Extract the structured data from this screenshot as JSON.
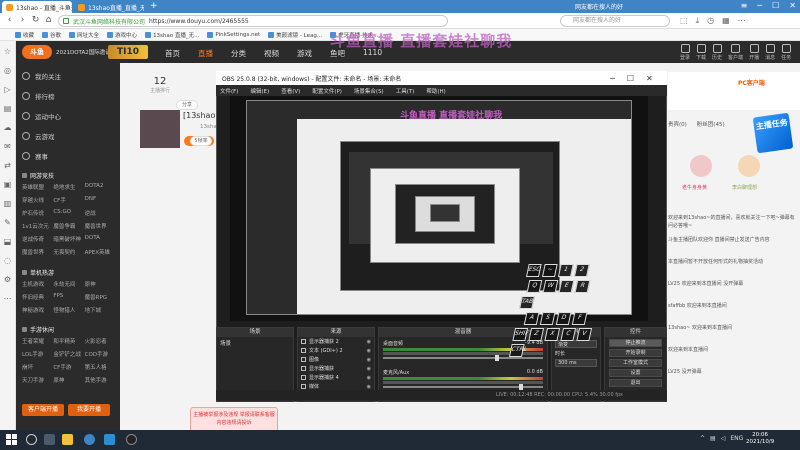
{
  "browser": {
    "tabs": [
      {
        "label": "13shao - 直播_斗鱼无限画质_无弹幕"
      },
      {
        "label": "13shao直播_直播_无弹幕"
      }
    ],
    "url": "https://www.douyu.com/2465555",
    "cert_owner": "武汉斗鱼网络科技有限公司",
    "search_placeholder": "网友都在搜人的好",
    "promo": "网友都在搜人的好",
    "bookmarks": [
      "收藏",
      "谷歌",
      "网址大全",
      "游戏中心",
      "13shao 直播_无...",
      "PinkSettings.net",
      "美颜滤镜 - Leag...",
      "虎牙直播-技术..."
    ]
  },
  "douyu": {
    "event_text": "2021DOTA2国际邀请赛",
    "logo_text": "斗鱼",
    "event_logo": "TI10",
    "nav": [
      "首页",
      "直播",
      "分类",
      "视频",
      "游戏",
      "鱼吧",
      "1110"
    ],
    "header_right": [
      "登录",
      "下载",
      "历史",
      "客户端",
      "开播",
      "消息",
      "任务"
    ],
    "overlay_title": "斗鱼直播 直播套娃社聊我",
    "sidebar_top": [
      "我的关注",
      "排行榜",
      "运动中心",
      "云游戏",
      "赛事"
    ],
    "sections": [
      {
        "title": "网游竞技",
        "items": [
          "英雄联盟",
          "绝地求生",
          "DOTA2",
          "穿越火线",
          "CF手",
          "DNF",
          "炉石传说",
          "CS:GO",
          "逆战",
          "1v1云次元",
          "魔兽争霸",
          "魔兽世界",
          "逆战传奇",
          "暗黑破坏神",
          "DOTA",
          "魔兽世界",
          "无畏契约",
          "APEX英雄"
        ]
      },
      {
        "title": "单机热游",
        "items": [
          "主机游戏",
          "永劫无间",
          "原神",
          "怀旧经典",
          "FPS",
          "魔兽RPG",
          "神秘游戏",
          "怪物猎人",
          "地下城"
        ]
      },
      {
        "title": "手游休闲",
        "items": [
          "王者荣耀",
          "和平精英",
          "火影忍者",
          "LOL手游",
          "金铲铲之战",
          "COD手游",
          "崩坏",
          "CF手游",
          "第五人格",
          "天刀手游",
          "原神",
          "其他手游"
        ]
      }
    ],
    "sidebar_buttons": [
      "客户端开播",
      "我要开播"
    ],
    "rank_count": "12",
    "rank_label": "主播排行",
    "subscribe": "+ 关注",
    "anchor_name": "[13shao]",
    "anchor_id": "13shao",
    "report": "举报",
    "bullet_buttons": [
      "分享",
      "5帧率"
    ],
    "pc_client": "PC客户端",
    "right_tabs": [
      "贵宾(0)",
      "粉丝团(45)"
    ],
    "guard_label": "主播任务",
    "avatars": [
      {
        "name": "老牛身身黄"
      },
      {
        "name": "李白聊理想"
      }
    ],
    "chat": [
      "欢迎来到13shao~的直播间，喜欢就关注一下吧~弹幕有问必答哦~",
      "斗鱼主播团队欢迎你 直播间禁止发送广告内容",
      "本直播间暂不开放任何形式的礼物抽奖活动",
      "LV25 欢迎来到本直播间 没开弹幕",
      "sfaffbb 欢迎来到本直播间",
      "13shao~ 欢迎来到本直播间",
      "欢迎来到本直播间",
      "LV25 没开弹幕"
    ],
    "bottom_note": "主播被举报涉及违规 举报请联系客服 内容违规请投诉"
  },
  "obs": {
    "title": "OBS 25.0.8 (32-bit, windows) - 配置文件: 未命名 - 场景: 未命名",
    "menu": [
      "文件(F)",
      "编辑(E)",
      "查看(V)",
      "配置文件(P)",
      "场景集合(S)",
      "工具(T)",
      "帮助(H)"
    ],
    "preview_title": "斗鱼直播 直播套娃社聊我",
    "docks": {
      "scenes": {
        "title": "场景",
        "items": [
          "场景"
        ]
      },
      "sources": {
        "title": "来源",
        "items": [
          "显示器捕获 2",
          "文本 (GDI+) 2",
          "图像",
          "显示器捕获",
          "显示器捕获 4",
          "媒体"
        ]
      },
      "mixer": {
        "title": "混音器",
        "tracks": [
          {
            "name": "桌面音频",
            "db": "-9.4 dB"
          },
          {
            "name": "麦克风/Aux",
            "db": "0.0 dB"
          }
        ]
      },
      "transitions": {
        "title": "转场特效",
        "label": "渐变",
        "duration_label": "时长",
        "duration": "300 ms"
      },
      "controls": {
        "title": "控件",
        "buttons": [
          "停止推流",
          "开始录制",
          "工作室模式",
          "设置",
          "退出"
        ]
      }
    },
    "status": "LIVE: 00:12:48  REC: 00:00:00  CPU: 5.4%  30.00 fps"
  },
  "keyboard": {
    "keys": [
      "ESC",
      "~",
      "1",
      "2",
      "Q",
      "W",
      "E",
      "R",
      "TAB",
      "A",
      "S",
      "D",
      "F",
      "SHIFT",
      "Z",
      "X",
      "C",
      "V",
      "CTRL"
    ]
  },
  "taskbar": {
    "tray": [
      "^",
      "ENG"
    ],
    "time": "20:06",
    "date": "2021/10/9"
  },
  "colors": {
    "browser_blue": "#3f84c5",
    "douyu_dark": "#2b2b2b",
    "douyu_orange": "#ff7a1a",
    "obs_bg": "#1e1e1e",
    "overlay_purple": "#c05fc0"
  }
}
